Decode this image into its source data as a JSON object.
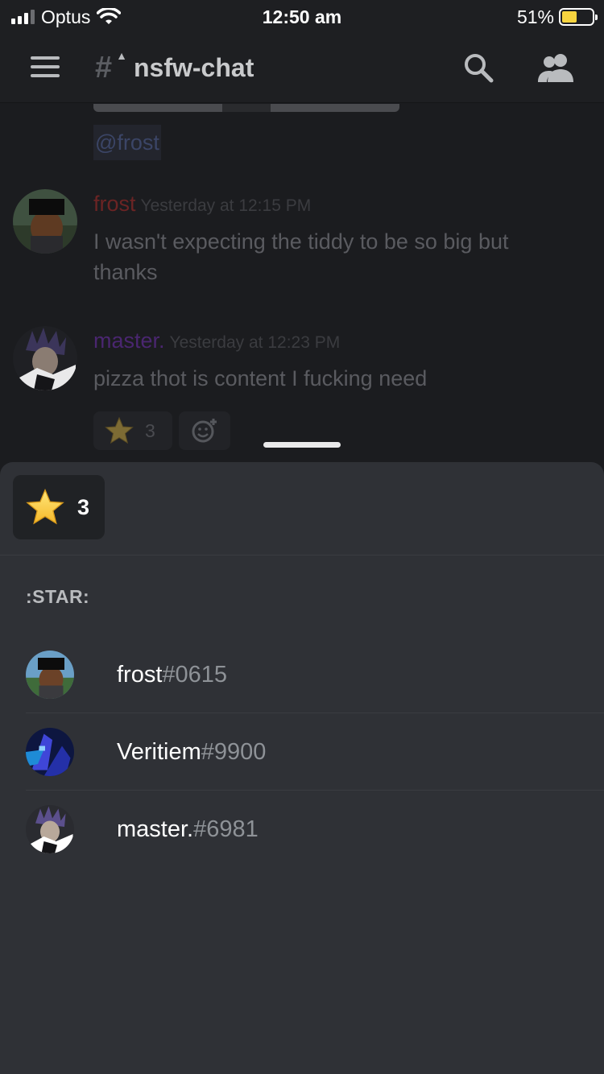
{
  "status_bar": {
    "carrier": "Optus",
    "time": "12:50 am",
    "battery_percent_label": "51%",
    "battery_level": 0.51,
    "battery_color": "#f7d43f"
  },
  "header": {
    "channel_name": "nsfw-chat",
    "menu_icon": "hamburger-icon",
    "channel_icon": "nsfw-hash-warning-icon",
    "search_icon": "search-icon",
    "members_icon": "members-icon"
  },
  "chat": {
    "mention": "@frost",
    "messages": [
      {
        "author": "frost",
        "author_color": "#6b2424",
        "timestamp": "Yesterday at 12:15 PM",
        "text": "I wasn't expecting the tiddy to be so big but thanks"
      },
      {
        "author": "master.",
        "author_color": "#4a2670",
        "timestamp": "Yesterday at 12:23 PM",
        "text": "pizza thot is content I fucking need"
      }
    ],
    "reaction": {
      "emoji_icon": "star-icon",
      "count": "3"
    },
    "add_reaction_icon": "add-reaction-icon"
  },
  "sheet": {
    "reaction": {
      "emoji_icon": "star-icon",
      "count": "3"
    },
    "emoji_title": ":STAR:",
    "users": [
      {
        "name": "frost",
        "discriminator": "#0615"
      },
      {
        "name": "Veritiem",
        "discriminator": "#9900"
      },
      {
        "name": "master.",
        "discriminator": "#6981"
      }
    ]
  }
}
